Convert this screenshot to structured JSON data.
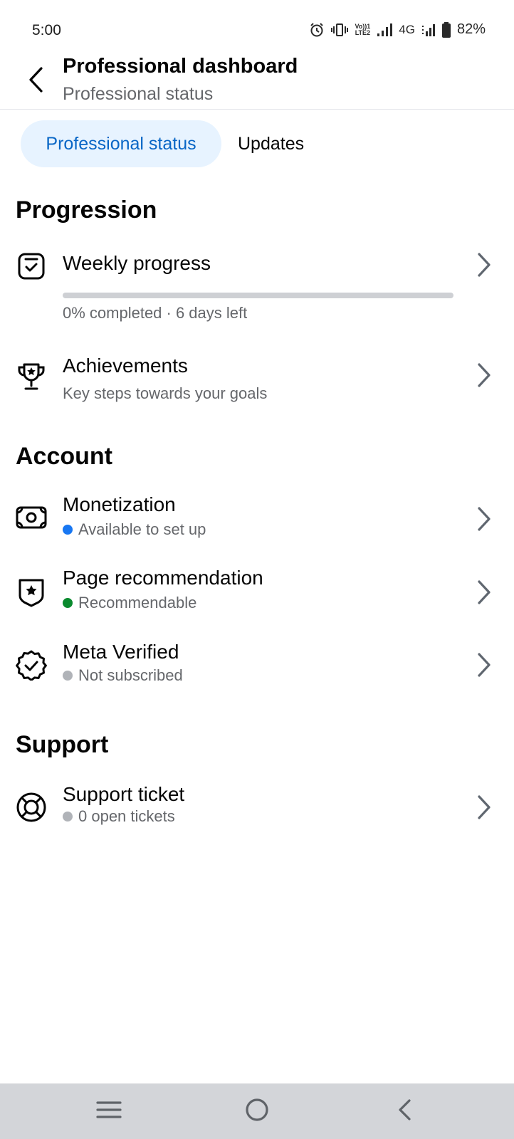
{
  "status_bar": {
    "time": "5:00",
    "icons": [
      "alarm-icon",
      "vibrate-icon",
      "volte-icon",
      "signal-icon",
      "signal-icon"
    ],
    "volte_top": "Vo))1",
    "volte_bottom": "LTE2",
    "network": "4G",
    "battery": "82%"
  },
  "header": {
    "back_icon": "chevron-left-icon",
    "title": "Professional dashboard",
    "subtitle": "Professional status"
  },
  "tabs": [
    {
      "label": "Professional status",
      "active": true
    },
    {
      "label": "Updates",
      "active": false
    }
  ],
  "sections": {
    "progression": {
      "title": "Progression",
      "weekly": {
        "icon": "clipboard-check-icon",
        "title": "Weekly progress",
        "progress": 0,
        "status": "0% completed · 6 days left"
      },
      "achievements": {
        "icon": "trophy-icon",
        "title": "Achievements",
        "subtitle": "Key steps towards your goals"
      }
    },
    "account": {
      "title": "Account",
      "items": [
        {
          "icon": "money-icon",
          "title": "Monetization",
          "status": "Available to set up",
          "dot_color": "#1877f2"
        },
        {
          "icon": "shield-star-icon",
          "title": "Page recommendation",
          "status": "Recommendable",
          "dot_color": "#0a8a2e"
        },
        {
          "icon": "verified-badge-icon",
          "title": "Meta Verified",
          "status": "Not subscribed",
          "dot_color": "#b0b3b8"
        }
      ]
    },
    "support": {
      "title": "Support",
      "items": [
        {
          "icon": "lifebuoy-icon",
          "title": "Support ticket",
          "status": "0 open tickets",
          "dot_color": "#b0b3b8"
        }
      ]
    }
  },
  "nav_bar": {
    "buttons": [
      "menu-icon",
      "home-circle-icon",
      "back-triangle-icon"
    ]
  },
  "colors": {
    "accent": "#0866c6",
    "tab_active_bg": "#e7f3ff",
    "secondary_text": "#65676b",
    "nav_bg": "#d3d5d9"
  }
}
